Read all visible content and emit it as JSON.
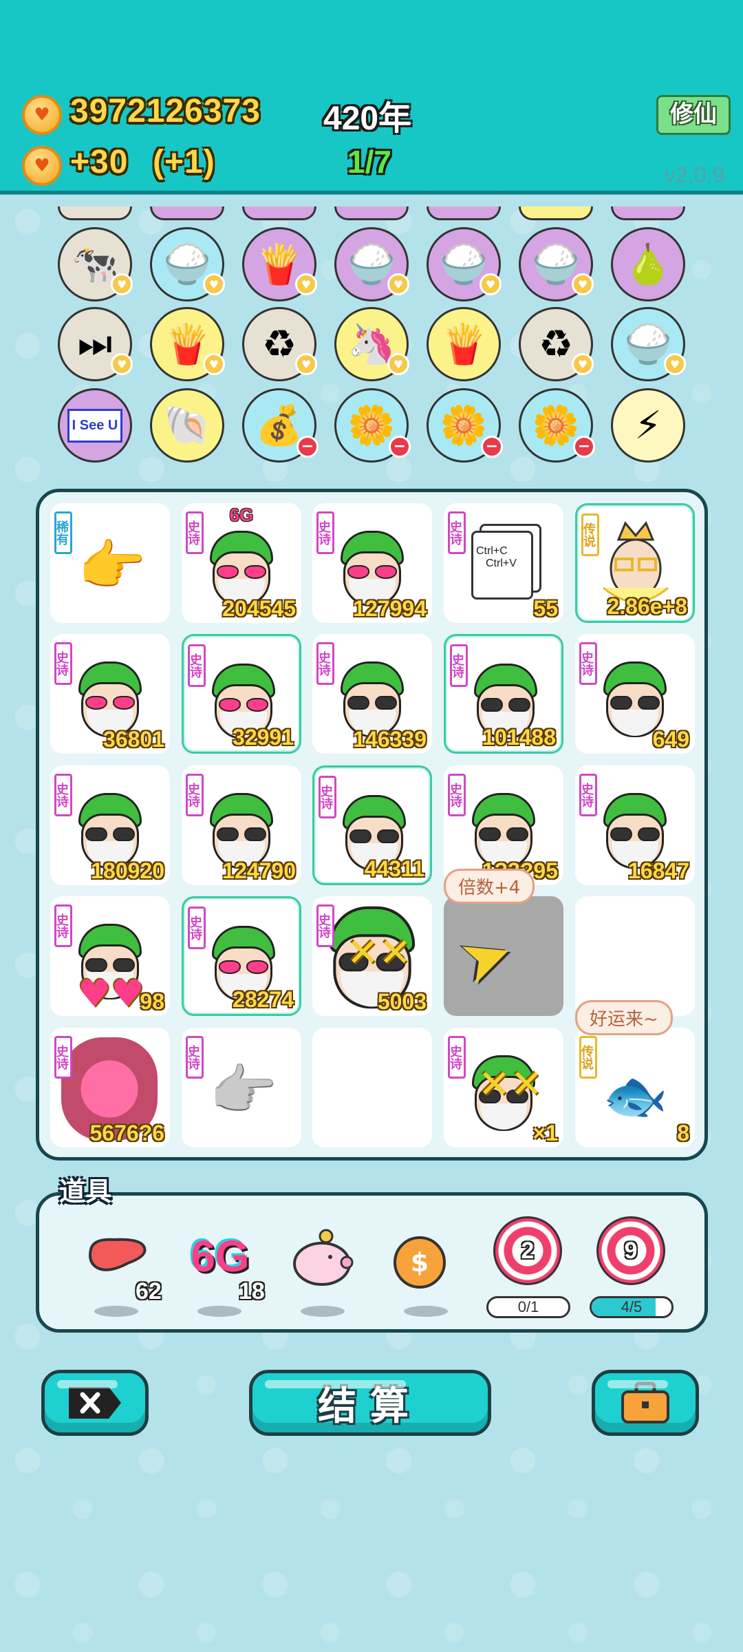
{
  "header": {
    "coins": "3972126373",
    "income": "+30",
    "income_bonus": "(+1)",
    "year": "420年",
    "round": "1/7",
    "xiuxian_label": "修仙",
    "version": "v2.0.9"
  },
  "relics": [
    {
      "icon": "cows-icon",
      "glyph": "🐄",
      "color": "beige",
      "badge": "heart"
    },
    {
      "icon": "rice-bowl-icon",
      "glyph": "🍚",
      "color": "cyan",
      "badge": "heart"
    },
    {
      "icon": "fries-icon",
      "glyph": "🍟",
      "color": "purple",
      "badge": "heart"
    },
    {
      "icon": "rice-bowl-icon",
      "glyph": "🍚",
      "color": "purple",
      "badge": "heart"
    },
    {
      "icon": "rice-bowl-icon",
      "glyph": "🍚",
      "color": "purple",
      "badge": "heart"
    },
    {
      "icon": "rice-bowl-icon",
      "glyph": "🍚",
      "color": "purple",
      "badge": "heart"
    },
    {
      "icon": "pear-icon",
      "glyph": "🍐",
      "color": "purple",
      "badge": "none"
    },
    {
      "icon": "skip-icon",
      "glyph": "⏭",
      "color": "beige",
      "badge": "heart"
    },
    {
      "icon": "fries-icon",
      "glyph": "🍟",
      "color": "yellow",
      "badge": "heart"
    },
    {
      "icon": "recycle-icon",
      "glyph": "♻",
      "color": "beige",
      "badge": "heart"
    },
    {
      "icon": "unicorn-icon",
      "glyph": "🦄",
      "color": "yellow",
      "badge": "heart"
    },
    {
      "icon": "fries-icon",
      "glyph": "🍟",
      "color": "yellow",
      "badge": "none"
    },
    {
      "icon": "recycle-icon",
      "glyph": "♻",
      "color": "beige",
      "badge": "heart"
    },
    {
      "icon": "rice-bowl-icon",
      "glyph": "🍚",
      "color": "cyan",
      "badge": "heart"
    },
    {
      "icon": "i-see-u-icon",
      "glyph": "I See U",
      "color": "purple",
      "badge": "none"
    },
    {
      "icon": "shell-icon",
      "glyph": "🐚",
      "color": "yellow",
      "badge": "none"
    },
    {
      "icon": "bag-icon",
      "glyph": "💰",
      "color": "cyan",
      "badge": "minus"
    },
    {
      "icon": "flower-pot-icon",
      "glyph": "🌼",
      "color": "cyan",
      "badge": "minus"
    },
    {
      "icon": "flower-pot-icon",
      "glyph": "🌼",
      "color": "cyan",
      "badge": "minus"
    },
    {
      "icon": "flower-pot-icon",
      "glyph": "🌼",
      "color": "cyan",
      "badge": "minus"
    },
    {
      "icon": "lightning-icon",
      "glyph": "⚡",
      "color": "pale",
      "badge": "none"
    }
  ],
  "board": {
    "cells": [
      {
        "kind": "hand",
        "tag": "稀有",
        "tag_type": "rare",
        "value": ""
      },
      {
        "kind": "face-pink",
        "tag": "史诗",
        "tag_type": "epic",
        "value": "204545",
        "top": "6G"
      },
      {
        "kind": "face-pink",
        "tag": "史诗",
        "tag_type": "epic",
        "value": "127994"
      },
      {
        "kind": "ctrl",
        "tag": "史诗",
        "tag_type": "epic",
        "value": "55",
        "ctrl_c": "Ctrl+C",
        "ctrl_v": "Ctrl+V"
      },
      {
        "kind": "king",
        "tag": "传说",
        "tag_type": "legend",
        "value": "2.86e+8",
        "glow": true
      },
      {
        "kind": "face-pink",
        "tag": "史诗",
        "tag_type": "epic",
        "value": "36801"
      },
      {
        "kind": "face-pink",
        "tag": "史诗",
        "tag_type": "epic",
        "value": "32991",
        "glow": true
      },
      {
        "kind": "face",
        "tag": "史诗",
        "tag_type": "epic",
        "value": "146339"
      },
      {
        "kind": "face",
        "tag": "史诗",
        "tag_type": "epic",
        "value": "101488",
        "glow": true
      },
      {
        "kind": "face",
        "tag": "史诗",
        "tag_type": "epic",
        "value": "649"
      },
      {
        "kind": "face",
        "tag": "史诗",
        "tag_type": "epic",
        "value": "180920"
      },
      {
        "kind": "face",
        "tag": "史诗",
        "tag_type": "epic",
        "value": "124790"
      },
      {
        "kind": "face",
        "tag": "史诗",
        "tag_type": "epic",
        "value": "44311",
        "glow": true
      },
      {
        "kind": "face",
        "tag": "史诗",
        "tag_type": "epic",
        "value": "1?3?95"
      },
      {
        "kind": "face",
        "tag": "史诗",
        "tag_type": "epic",
        "value": "16847"
      },
      {
        "kind": "face-hearts",
        "tag": "史诗",
        "tag_type": "epic",
        "value": "98"
      },
      {
        "kind": "face-pink",
        "tag": "史诗",
        "tag_type": "epic",
        "value": "28274",
        "glow": true
      },
      {
        "kind": "face-zoom",
        "tag": "史诗",
        "tag_type": "epic",
        "value": "5003"
      },
      {
        "kind": "arrow",
        "tag": "",
        "tag_type": "",
        "value": "",
        "bubble": "倍数+4"
      },
      {
        "kind": "empty",
        "tag": "",
        "tag_type": "",
        "value": ""
      },
      {
        "kind": "girl",
        "tag": "史诗",
        "tag_type": "epic",
        "value": "5676?6"
      },
      {
        "kind": "hand-grey",
        "tag": "史诗",
        "tag_type": "epic",
        "value": ""
      },
      {
        "kind": "empty",
        "tag": "",
        "tag_type": "",
        "value": ""
      },
      {
        "kind": "face-burst",
        "tag": "史诗",
        "tag_type": "epic",
        "value": "×1"
      },
      {
        "kind": "fish",
        "tag": "传说",
        "tag_type": "legend",
        "value": "8",
        "bubble": "好运来~"
      }
    ]
  },
  "items": {
    "title": "道具",
    "list": [
      {
        "icon": "liver-icon",
        "count": "62"
      },
      {
        "icon": "6g-icon",
        "label": "6G",
        "count": "18"
      },
      {
        "icon": "piggy-bank-icon",
        "count": ""
      },
      {
        "icon": "coin-icon",
        "count": ""
      }
    ],
    "targets": [
      {
        "icon": "target-icon",
        "value": "2",
        "progress": "0/1",
        "ratio": 0.0
      },
      {
        "icon": "target-icon",
        "value": "9",
        "progress": "4/5",
        "ratio": 0.8
      }
    ]
  },
  "buttons": {
    "settle_label": "结算"
  }
}
